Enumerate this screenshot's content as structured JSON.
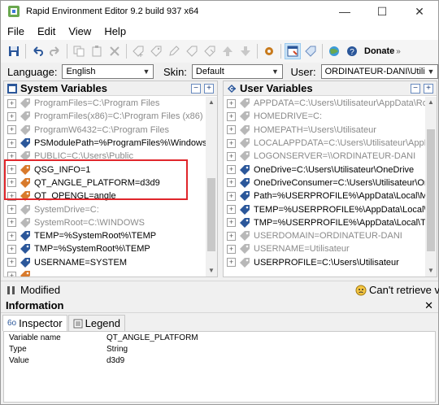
{
  "window": {
    "title": "Rapid Environment Editor 9.2 build 937 x64",
    "controls": [
      "—",
      "☐",
      "✕"
    ]
  },
  "menu": [
    "File",
    "Edit",
    "View",
    "Help"
  ],
  "toolbar": {
    "donate_label": "Donate"
  },
  "selectors": {
    "language_label": "Language:",
    "language_value": "English",
    "skin_label": "Skin:",
    "skin_value": "Default",
    "user_label": "User:",
    "user_value": "ORDINATEUR-DANI\\Utilisateur"
  },
  "system_panel": {
    "title": "System Variables",
    "rows": [
      {
        "text": "ProgramFiles=C:\\Program Files",
        "dim": true,
        "icon": "grey"
      },
      {
        "text": "ProgramFiles(x86)=C:\\Program Files (x86)",
        "dim": true,
        "icon": "grey"
      },
      {
        "text": "ProgramW6432=C:\\Program Files",
        "dim": true,
        "icon": "grey"
      },
      {
        "text": "PSModulePath=%ProgramFiles%\\WindowsPowerShell\\M",
        "dim": false,
        "icon": "blue"
      },
      {
        "text": "PUBLIC=C:\\Users\\Public",
        "dim": true,
        "icon": "grey"
      },
      {
        "text": "QSG_INFO=1",
        "dim": false,
        "icon": "orange"
      },
      {
        "text": "QT_ANGLE_PLATFORM=d3d9",
        "dim": false,
        "icon": "orange"
      },
      {
        "text": "QT_OPENGL=angle",
        "dim": false,
        "icon": "orange"
      },
      {
        "text": "SystemDrive=C:",
        "dim": true,
        "icon": "grey"
      },
      {
        "text": "SystemRoot=C:\\WINDOWS",
        "dim": true,
        "icon": "grey"
      },
      {
        "text": "TEMP=%SystemRoot%\\TEMP",
        "dim": false,
        "icon": "blue"
      },
      {
        "text": "TMP=%SystemRoot%\\TEMP",
        "dim": false,
        "icon": "blue"
      },
      {
        "text": "USERNAME=SYSTEM",
        "dim": false,
        "icon": "blue"
      },
      {
        "text": "",
        "dim": true,
        "icon": "orange"
      }
    ]
  },
  "user_panel": {
    "title": "User Variables",
    "rows": [
      {
        "text": "APPDATA=C:\\Users\\Utilisateur\\AppData\\Roaming",
        "dim": true,
        "icon": "grey"
      },
      {
        "text": "HOMEDRIVE=C:",
        "dim": true,
        "icon": "grey"
      },
      {
        "text": "HOMEPATH=\\Users\\Utilisateur",
        "dim": true,
        "icon": "grey"
      },
      {
        "text": "LOCALAPPDATA=C:\\Users\\Utilisateur\\AppData\\Local",
        "dim": true,
        "icon": "grey"
      },
      {
        "text": "LOGONSERVER=\\\\ORDINATEUR-DANI",
        "dim": true,
        "icon": "grey"
      },
      {
        "text": "OneDrive=C:\\Users\\Utilisateur\\OneDrive",
        "dim": false,
        "icon": "blue"
      },
      {
        "text": "OneDriveConsumer=C:\\Users\\Utilisateur\\OneDrive",
        "dim": false,
        "icon": "blue"
      },
      {
        "text": "Path=%USERPROFILE%\\AppData\\Local\\Microsoft\\Win",
        "dim": false,
        "icon": "blue"
      },
      {
        "text": "TEMP=%USERPROFILE%\\AppData\\Local\\Temp",
        "dim": false,
        "icon": "blue"
      },
      {
        "text": "TMP=%USERPROFILE%\\AppData\\Local\\Temp",
        "dim": false,
        "icon": "blue"
      },
      {
        "text": "USERDOMAIN=ORDINATEUR-DANI",
        "dim": true,
        "icon": "grey"
      },
      {
        "text": "USERNAME=Utilisateur",
        "dim": true,
        "icon": "grey"
      },
      {
        "text": "USERPROFILE=C:\\Users\\Utilisateur",
        "dim": false,
        "icon": "grey"
      }
    ]
  },
  "status": {
    "modified": "Modified",
    "retrieve": "Can't retrieve ver"
  },
  "information": {
    "title": "Information",
    "tabs": [
      "Inspector",
      "Legend"
    ],
    "properties": [
      {
        "key": "Variable name",
        "value": "QT_ANGLE_PLATFORM"
      },
      {
        "key": "Type",
        "value": "String"
      },
      {
        "key": "Value",
        "value": "d3d9"
      }
    ]
  },
  "colors": {
    "highlight": "#e0262b",
    "accent": "#0078d7"
  }
}
